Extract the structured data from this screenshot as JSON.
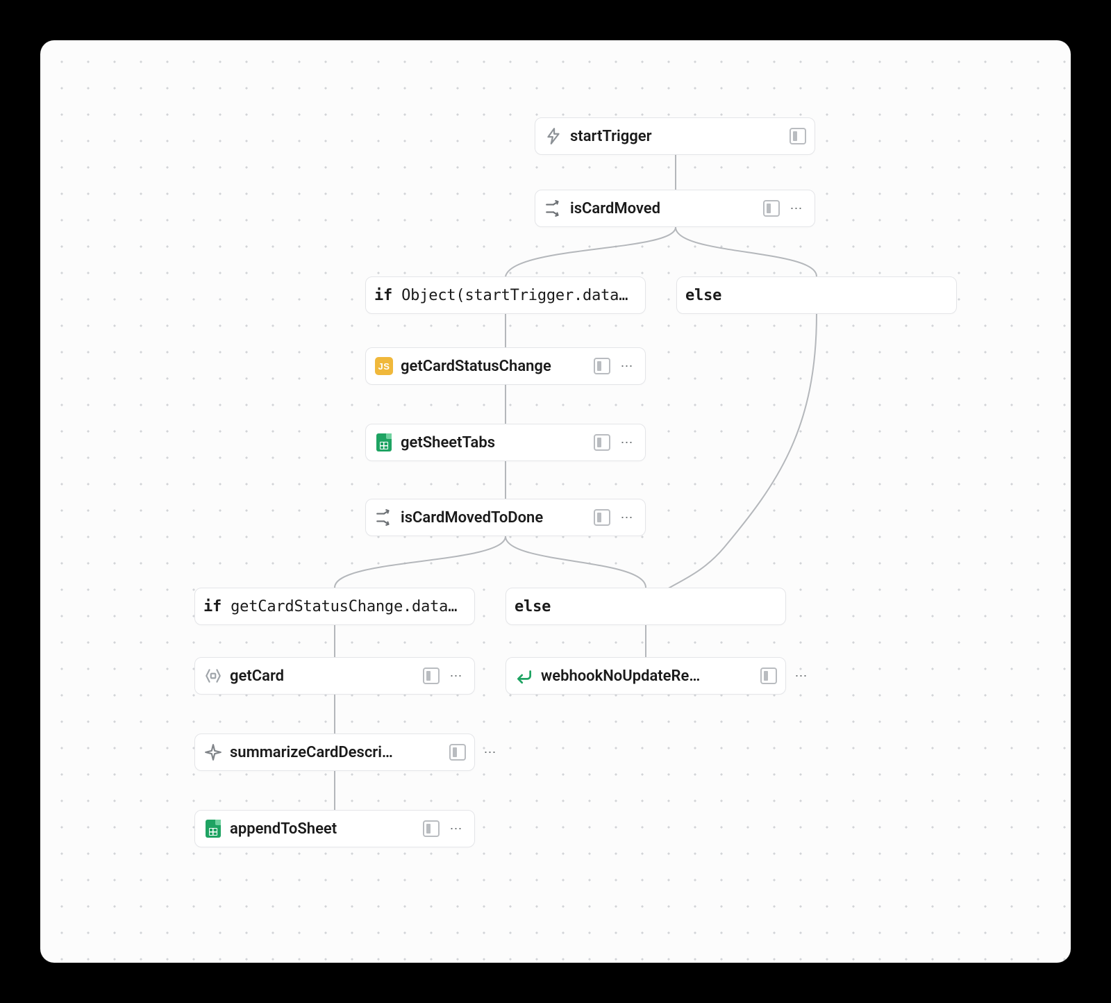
{
  "nodes": {
    "startTrigger": {
      "label": "startTrigger",
      "icon": "lightning"
    },
    "isCardMoved": {
      "label": "isCardMoved",
      "icon": "branch"
    },
    "cond1_if": {
      "keyword": "if",
      "expr": "Object(startTrigger.data…"
    },
    "cond1_else": {
      "keyword": "else",
      "expr": ""
    },
    "getCardStatusChange": {
      "label": "getCardStatusChange",
      "icon": "js"
    },
    "getSheetTabs": {
      "label": "getSheetTabs",
      "icon": "sheets"
    },
    "isCardMovedToDone": {
      "label": "isCardMovedToDone",
      "icon": "branch"
    },
    "cond2_if": {
      "keyword": "if",
      "expr": "getCardStatusChange.data…"
    },
    "cond2_else": {
      "keyword": "else",
      "expr": ""
    },
    "getCard": {
      "label": "getCard",
      "icon": "api"
    },
    "summarizeCardDescription": {
      "label": "summarizeCardDescri…",
      "icon": "sparkle"
    },
    "appendToSheet": {
      "label": "appendToSheet",
      "icon": "sheets"
    },
    "webhookNoUpdate": {
      "label": "webhookNoUpdateRe…",
      "icon": "return"
    }
  },
  "glyphs": {
    "more": "⋯"
  }
}
